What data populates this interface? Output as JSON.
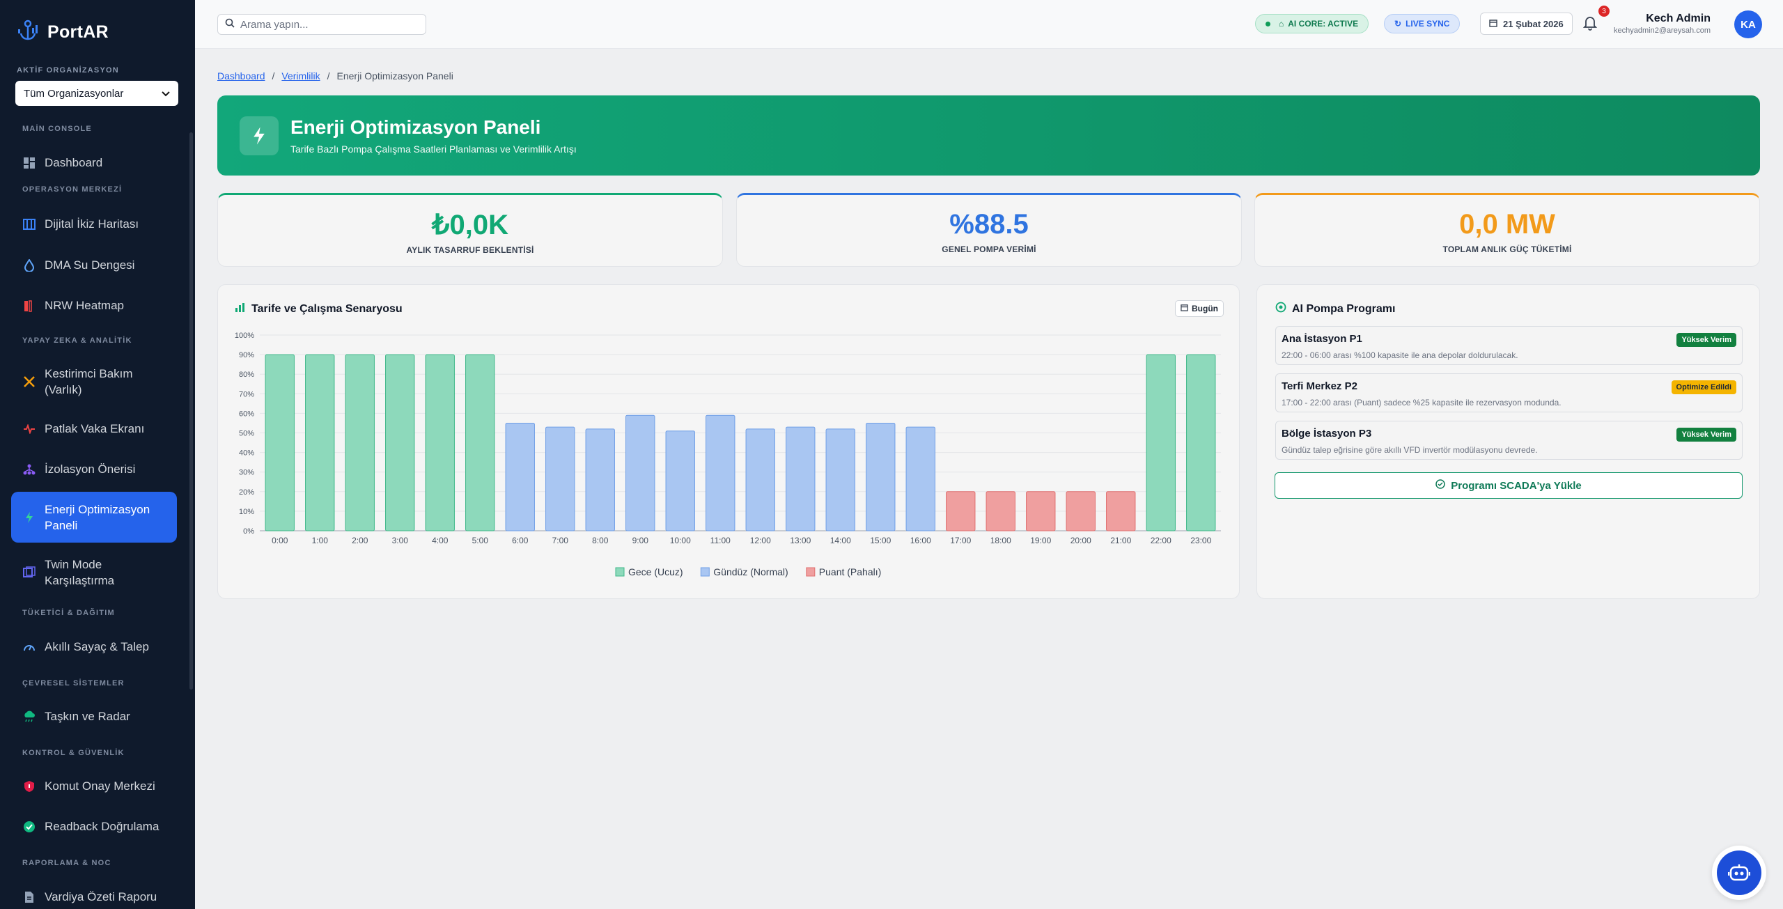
{
  "app": {
    "name": "PortAR"
  },
  "sidebar": {
    "org_label": "AKTİF ORGANİZASYON",
    "org_selected": "Tüm Organizasyonlar",
    "sections": {
      "main": "MAİN CONSOLE",
      "ops": "OPERASYON MERKEZİ",
      "ai": "YAPAY ZEKA & ANALİTİK",
      "consumer": "TÜKETİCİ & DAĞITIM",
      "env": "ÇEVRESEL SİSTEMLER",
      "control": "KONTROL & GÜVENLİK",
      "report": "RAPORLAMA & NOC"
    },
    "items": {
      "dashboard": "Dashboard",
      "digital_twin": "Dijital İkiz Haritası",
      "dma": "DMA Su Dengesi",
      "nrw": "NRW Heatmap",
      "maint_1": "Kestirimci Bakım",
      "maint_2": "(Varlık)",
      "burst": "Patlak Vaka Ekranı",
      "isolation": "İzolasyon Önerisi",
      "energy_1": "Enerji Optimizasyon",
      "energy_2": "Paneli",
      "twin_1": "Twin Mode",
      "twin_2": "Karşılaştırma",
      "meter": "Akıllı Sayaç & Talep",
      "flood": "Taşkın ve Radar",
      "command": "Komut Onay Merkezi",
      "readback": "Readback Doğrulama",
      "shift": "Vardiya Özeti Raporu"
    }
  },
  "topbar": {
    "search_placeholder": "Arama yapın...",
    "ai_core": "AI CORE: ACTIVE",
    "live_sync": "LIVE SYNC",
    "date": "21 Şubat 2026",
    "notif_count": "3",
    "user_name": "Kech Admin",
    "user_email": "kechyadmin2@areysah.com",
    "avatar": "KA"
  },
  "breadcrumb": {
    "home": "Dashboard",
    "section": "Verimlilik",
    "current": "Enerji Optimizasyon Paneli"
  },
  "hero": {
    "title": "Enerji Optimizasyon Paneli",
    "subtitle": "Tarife Bazlı Pompa Çalışma Saatleri Planlaması ve Verimlilik Artışı"
  },
  "kpis": {
    "savings": {
      "value": "₺0,0K",
      "label": "AYLIK TASARRUF BEKLENTİSİ"
    },
    "efficiency": {
      "value": "%88.5",
      "label": "GENEL POMPA VERİMİ"
    },
    "power": {
      "value": "0,0 MW",
      "label": "TOPLAM ANLIK GÜÇ TÜKETİMİ"
    }
  },
  "colors": {
    "green": "#10a874",
    "blue": "#2f74e0",
    "orange": "#f29a1a"
  },
  "chart_card": {
    "title": "Tarife ve Çalışma Senaryosu",
    "today": "Bugün"
  },
  "chart_data": {
    "type": "bar",
    "title": "Tarife ve Çalışma Senaryosu",
    "categories": [
      "0:00",
      "1:00",
      "2:00",
      "3:00",
      "4:00",
      "5:00",
      "6:00",
      "7:00",
      "8:00",
      "9:00",
      "10:00",
      "11:00",
      "12:00",
      "13:00",
      "14:00",
      "15:00",
      "16:00",
      "17:00",
      "18:00",
      "19:00",
      "20:00",
      "21:00",
      "22:00",
      "23:00"
    ],
    "values": [
      90,
      90,
      90,
      90,
      90,
      90,
      55,
      53,
      52,
      59,
      51,
      59,
      52,
      53,
      52,
      55,
      53,
      20,
      20,
      20,
      20,
      20,
      90,
      90
    ],
    "tariff": [
      "Gece (Ucuz)",
      "Gece (Ucuz)",
      "Gece (Ucuz)",
      "Gece (Ucuz)",
      "Gece (Ucuz)",
      "Gece (Ucuz)",
      "Gündüz (Normal)",
      "Gündüz (Normal)",
      "Gündüz (Normal)",
      "Gündüz (Normal)",
      "Gündüz (Normal)",
      "Gündüz (Normal)",
      "Gündüz (Normal)",
      "Gündüz (Normal)",
      "Gündüz (Normal)",
      "Gündüz (Normal)",
      "Gündüz (Normal)",
      "Puant (Pahalı)",
      "Puant (Pahalı)",
      "Puant (Pahalı)",
      "Puant (Pahalı)",
      "Puant (Pahalı)",
      "Gece (Ucuz)",
      "Gece (Ucuz)"
    ],
    "legend": [
      {
        "name": "Gece (Ucuz)",
        "fill": "#8dd9bb",
        "stroke": "#3fb889"
      },
      {
        "name": "Gündüz (Normal)",
        "fill": "#a9c6f2",
        "stroke": "#6f9ee6"
      },
      {
        "name": "Puant (Pahalı)",
        "fill": "#ef9f9f",
        "stroke": "#e07070"
      }
    ],
    "yticks": [
      "0%",
      "10%",
      "20%",
      "30%",
      "40%",
      "50%",
      "60%",
      "70%",
      "80%",
      "90%",
      "100%"
    ],
    "ylim": [
      0,
      100
    ],
    "grid": true,
    "legend_position": "bottom"
  },
  "program": {
    "title": "AI Pompa Programı",
    "items": [
      {
        "name": "Ana İstasyon P1",
        "desc": "22:00 - 06:00 arası %100 kapasite ile ana depolar doldurulacak.",
        "tag": "Yüksek Verim",
        "tag_bg": "#12803f",
        "tag_color": "#ffffff"
      },
      {
        "name": "Terfi Merkez P2",
        "desc": "17:00 - 22:00 arası (Puant) sadece %25 kapasite ile rezervasyon modunda.",
        "tag": "Optimize Edildi",
        "tag_bg": "#f4b400",
        "tag_color": "#1f2937"
      },
      {
        "name": "Bölge İstasyon P3",
        "desc": "Gündüz talep eğrisine göre akıllı VFD invertör modülasyonu devrede.",
        "tag": "Yüksek Verim",
        "tag_bg": "#12803f",
        "tag_color": "#ffffff"
      }
    ],
    "button": "Programı SCADA'ya Yükle"
  }
}
